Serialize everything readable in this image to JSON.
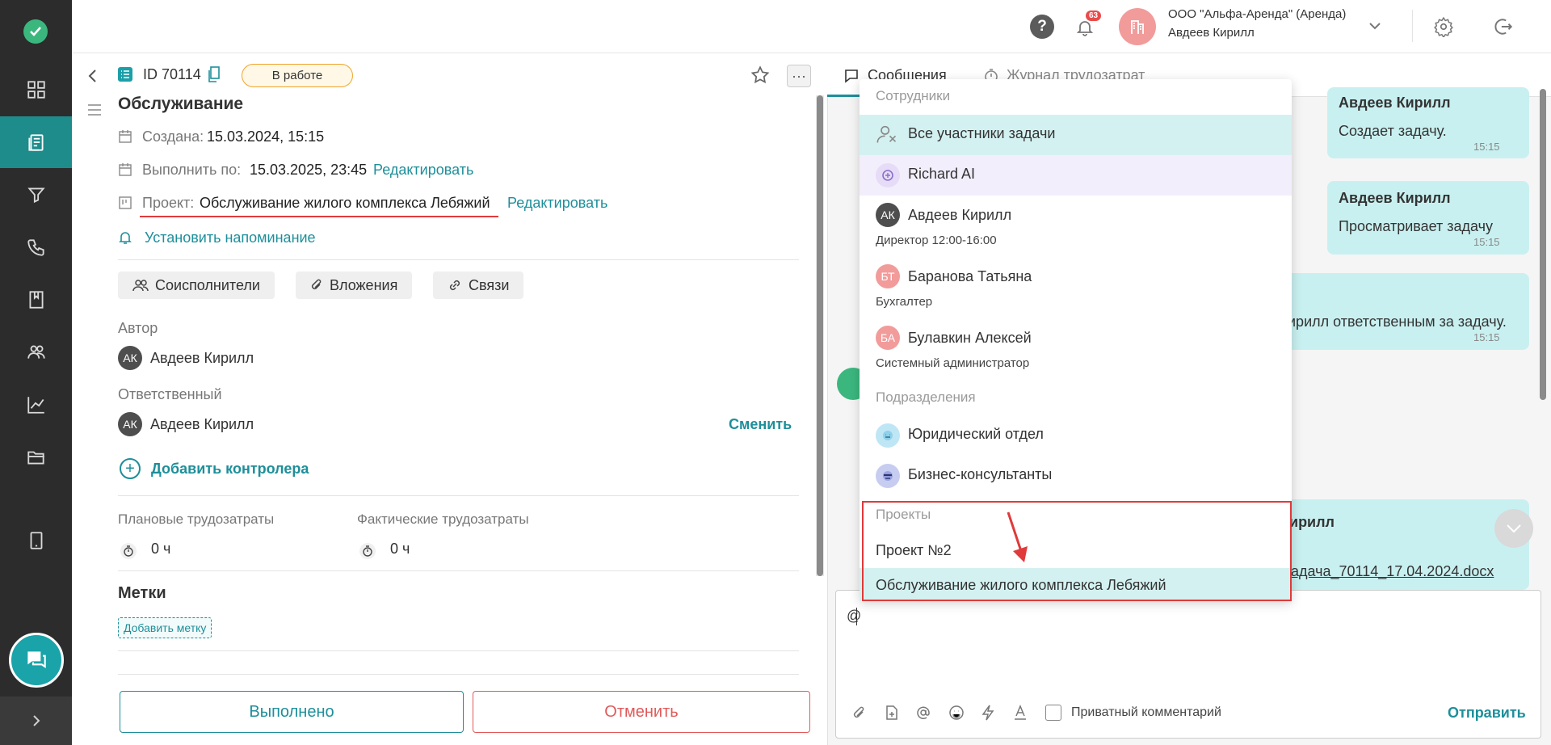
{
  "header": {
    "help_label": "?",
    "notifications_count": "63",
    "org_name": "ООО \"Альфа-Аренда\" (Аренда)",
    "user_name": "Авдеев Кирилл"
  },
  "task": {
    "id": "ID 70114",
    "status": "В работе",
    "title": "Обслуживание",
    "created_label": "Создана:",
    "created_value": "15.03.2024, 15:15",
    "due_label": "Выполнить по:",
    "due_value": "15.03.2025, 23:45",
    "edit_label": "Редактировать",
    "project_label": "Проект:",
    "project_value": "Обслуживание жилого комплекса Лебяжий",
    "reminder": "Установить напоминание",
    "chips": [
      "Соисполнители",
      "Вложения",
      "Связи"
    ],
    "author_label": "Автор",
    "author_initials": "АК",
    "author_name": "Авдеев Кирилл",
    "responsible_label": "Ответственный",
    "responsible_initials": "АК",
    "responsible_name": "Авдеев Кирилл",
    "change_label": "Сменить",
    "add_controller": "Добавить контролера",
    "planned_label": "Плановые трудозатраты",
    "planned_value": "0 ч",
    "actual_label": "Фактические трудозатраты",
    "actual_value": "0 ч",
    "tags_label": "Метки",
    "add_tag": "Добавить метку",
    "done_button": "Выполнено",
    "cancel_button": "Отменить"
  },
  "chat": {
    "tabs": [
      "Сообщения",
      "Журнал трудозатрат"
    ],
    "messages": [
      {
        "author": "Авдеев Кирилл",
        "text": "Создает задачу.",
        "time": "15:15"
      },
      {
        "author": "Авдеев Кирилл",
        "text": "Просматривает задачу",
        "time": "15:15"
      },
      {
        "author": "",
        "text": "ирилл ответственным за задачу.",
        "time": "15:15"
      },
      {
        "author": "ирилл",
        "text": "адача_70114_17.04.2024.docx",
        "time": ""
      }
    ],
    "input_value": "@",
    "private_comment": "Приватный комментарий",
    "send_button": "Отправить"
  },
  "mention_dropdown": {
    "employees_header": "Сотрудники",
    "all_participants": "Все участники задачи",
    "people": [
      {
        "initials": "",
        "name": "Richard AI",
        "role": "",
        "color": "#a98fd6"
      },
      {
        "initials": "АК",
        "name": "Авдеев Кирилл",
        "role": "Директор 12:00-16:00",
        "color": "#4e4e4e"
      },
      {
        "initials": "БТ",
        "name": "Баранова Татьяна",
        "role": "Бухгалтер",
        "color": "#f29b9b"
      },
      {
        "initials": "БА",
        "name": "Булавкин Алексей",
        "role": "Системный администратор",
        "color": "#f29b9b"
      }
    ],
    "departments_header": "Подразделения",
    "departments": [
      "Юридический отдел",
      "Бизнес-консультанты"
    ],
    "projects_header": "Проекты",
    "projects": [
      "Проект №2",
      "Обслуживание жилого комплекса Лебяжий"
    ]
  },
  "colors": {
    "accent": "#1d8f9a",
    "rail": "#2c2c2c",
    "bubble": "#c9f0f0",
    "highlight": "#e03a3a"
  }
}
